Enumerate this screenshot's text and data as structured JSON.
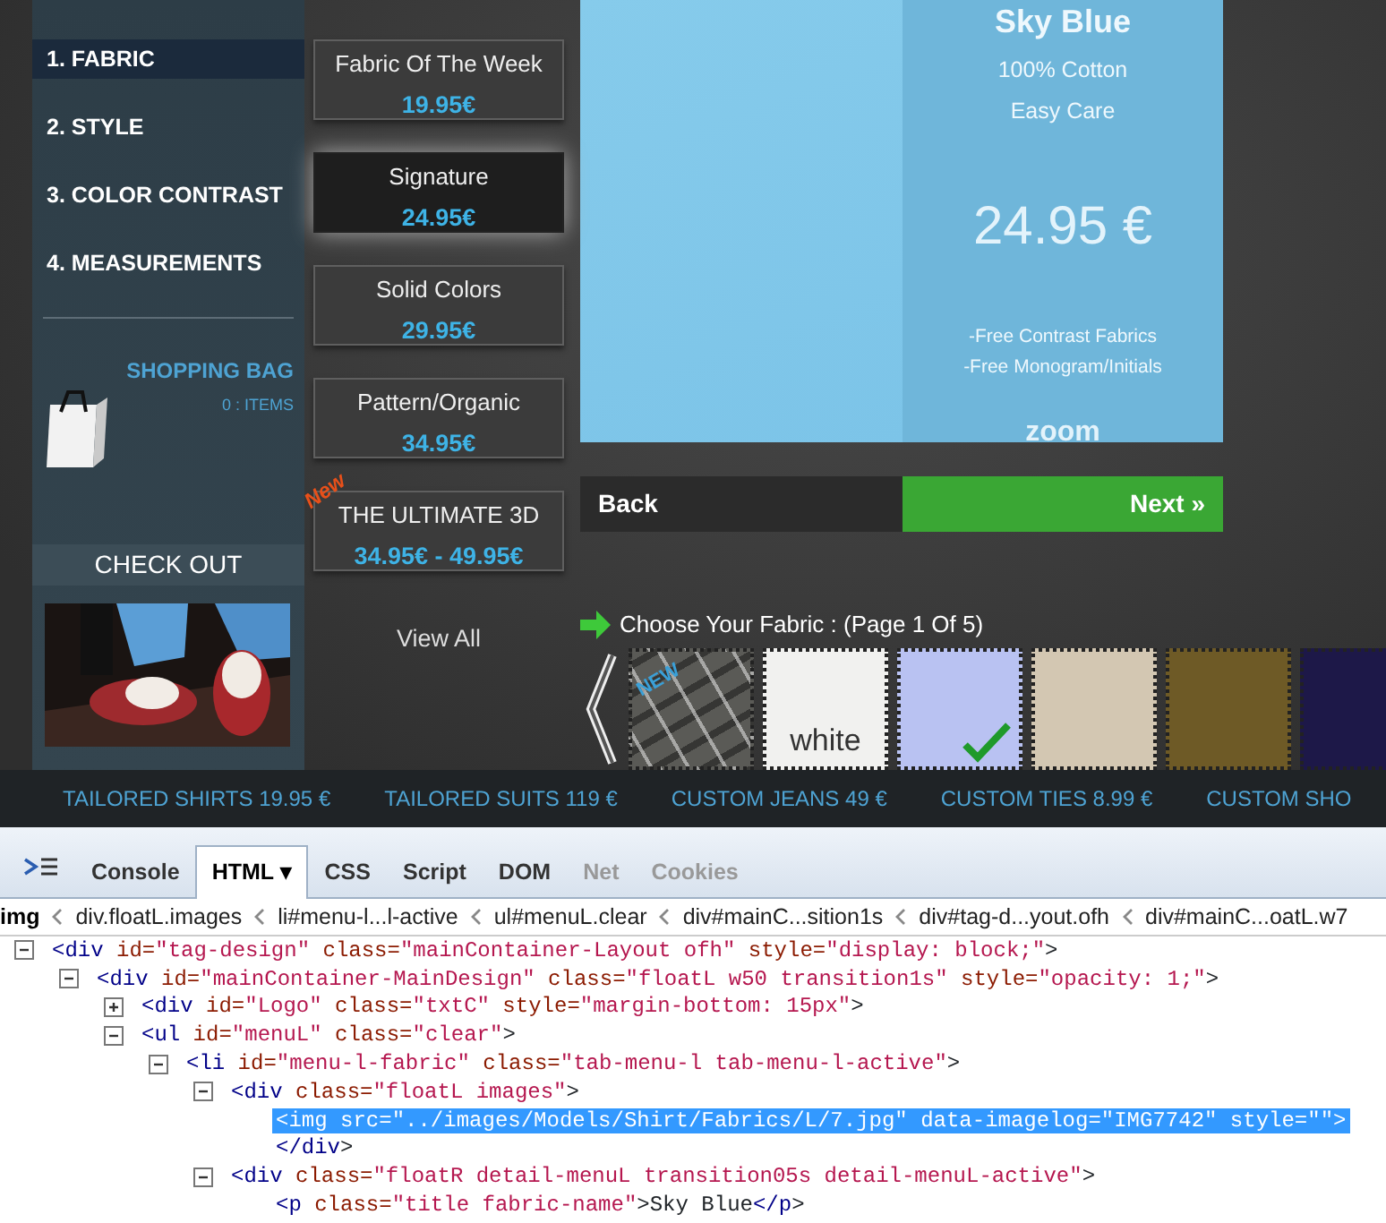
{
  "steps": [
    {
      "number": "1.",
      "label": "FABRIC",
      "selected": true
    },
    {
      "number": "2.",
      "label": "STYLE",
      "selected": false
    },
    {
      "number": "3.",
      "label": "COLOR CONTRAST",
      "selected": false
    },
    {
      "number": "4.",
      "label": "MEASUREMENTS",
      "selected": false
    }
  ],
  "shopping_bag": {
    "title": "SHOPPING BAG",
    "count": "0 : ITEMS"
  },
  "checkout": "CHECK OUT",
  "photo": {
    "kind": "picture"
  },
  "categories": [
    {
      "name": "Fabric Of The Week",
      "price": "19.95€",
      "selected": false
    },
    {
      "name": "Signature",
      "price": "24.95€",
      "selected": true
    },
    {
      "name": "Solid Colors",
      "price": "29.95€",
      "selected": false
    },
    {
      "name": "Pattern/Organic",
      "price": "34.95€",
      "selected": false
    },
    {
      "name": "THE ULTIMATE 3D",
      "price": "34.95€ - 49.95€",
      "selected": false,
      "badge": "New"
    }
  ],
  "view_all": "View All",
  "preview": {
    "name": "Sky Blue",
    "details": [
      "100% Cotton",
      "Easy Care"
    ],
    "price": "24.95 €",
    "perks": [
      "-Free Contrast Fabrics",
      "-Free Monogram/Initials"
    ],
    "zoom": "zoom"
  },
  "nav": {
    "back": "Back",
    "next": "Next »"
  },
  "chooser": {
    "title": "Choose Your Fabric : (Page 1 Of 5)",
    "swatches": [
      {
        "kind": "plaid",
        "color": "#5a5a56",
        "badge": "NEW",
        "selected": false
      },
      {
        "kind": "solid",
        "color": "#f1f1ef",
        "label": "white",
        "selected": false
      },
      {
        "kind": "solid",
        "color": "#b9c2f2",
        "selected": true
      },
      {
        "kind": "solid",
        "color": "#d3c7b2",
        "selected": false
      },
      {
        "kind": "solid",
        "color": "#6e5a26",
        "selected": false
      },
      {
        "kind": "solid",
        "color": "#1d1848",
        "selected": false
      }
    ]
  },
  "bottom_links": [
    "TAILORED SHIRTS 19.95 €",
    "TAILORED SUITS 119 €",
    "CUSTOM JEANS 49 €",
    "CUSTOM TIES 8.99 €",
    "CUSTOM SHO"
  ],
  "devtools": {
    "tabs": [
      {
        "label": "Console",
        "selected": false,
        "disabled": false
      },
      {
        "label": "HTML",
        "selected": true,
        "disabled": false,
        "menu": "▾"
      },
      {
        "label": "CSS",
        "selected": false,
        "disabled": false
      },
      {
        "label": "Script",
        "selected": false,
        "disabled": false
      },
      {
        "label": "DOM",
        "selected": false,
        "disabled": false
      },
      {
        "label": "Net",
        "selected": false,
        "disabled": true
      },
      {
        "label": "Cookies",
        "selected": false,
        "disabled": true
      }
    ],
    "breadcrumbs": [
      {
        "label": "img",
        "selected": true
      },
      {
        "label": "div.floatL.images",
        "selected": false
      },
      {
        "label": "li#menu-l...l-active",
        "selected": false
      },
      {
        "label": "ul#menuL.clear",
        "selected": false
      },
      {
        "label": "div#mainC...sition1s",
        "selected": false
      },
      {
        "label": "div#tag-d...yout.ofh",
        "selected": false
      },
      {
        "label": "div#mainC...oatL.w7",
        "selected": false
      }
    ],
    "tree": [
      {
        "text": "<div id=\"tag-design\" class=\"mainContainer-Layout ofh\" style=\"display: block;\">",
        "expanded": true,
        "selected": false,
        "children": [
          {
            "text": "<div id=\"mainContainer-MainDesign\" class=\"floatL w50 transition1s\" style=\"opacity: 1;\">",
            "expanded": true,
            "selected": false,
            "children": [
              {
                "text": "<div id=\"Logo\" class=\"txtC\" style=\"margin-bottom: 15px\">",
                "expanded": false,
                "selected": false
              },
              {
                "text": "<ul id=\"menuL\" class=\"clear\">",
                "expanded": true,
                "selected": false,
                "children": [
                  {
                    "text": "<li id=\"menu-l-fabric\" class=\"tab-menu-l tab-menu-l-active\">",
                    "expanded": true,
                    "selected": false,
                    "children": [
                      {
                        "text": "<div class=\"floatL images\">",
                        "expanded": true,
                        "selected": false,
                        "close": "</div>",
                        "children": [
                          {
                            "text": "<img src=\"../images/Models/Shirt/Fabrics/L/7.jpg\" data-imagelog=\"IMG7742\" style=\"\">",
                            "selected": true
                          }
                        ]
                      },
                      {
                        "text": "<div class=\"floatR detail-menuL transition05s detail-menuL-active\">",
                        "expanded": true,
                        "selected": false,
                        "children": [
                          {
                            "text": "<p class=\"title fabric-name\">Sky Blue</p>",
                            "selected": false
                          }
                        ]
                      }
                    ]
                  }
                ]
              }
            ]
          }
        ]
      }
    ]
  }
}
